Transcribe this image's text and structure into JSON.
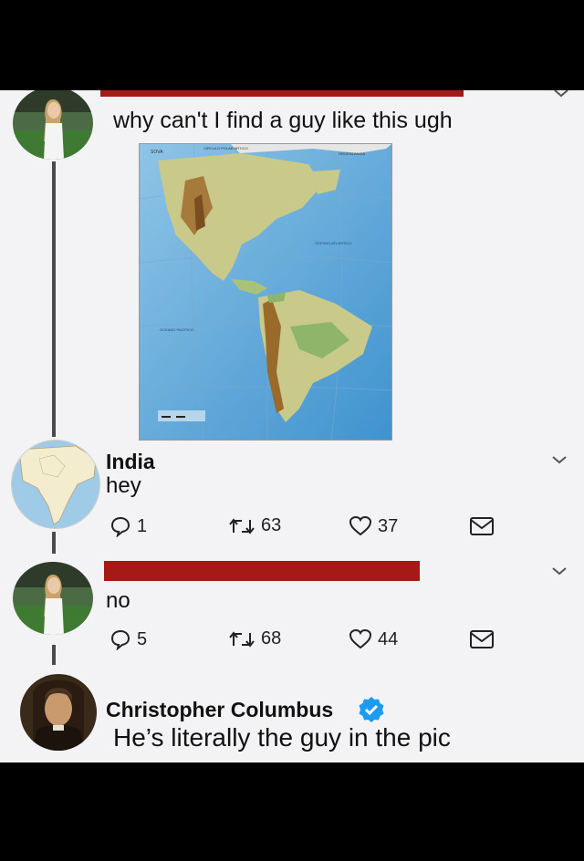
{
  "tweet1": {
    "text": "why can't I find a guy like this ugh"
  },
  "map": {
    "labels": {
      "top_left": "SOVA",
      "top": "CIRCULO POLAR ARTICO",
      "top_right": "GROENLANDIA",
      "ocean_right": "OCEANO ATLANTICO",
      "ocean_left": "OCEANO PACIFICO"
    }
  },
  "reply_india": {
    "name": "India",
    "text": "hey",
    "actions": {
      "replies": "1",
      "retweets": "63",
      "likes": "37"
    }
  },
  "reply2": {
    "text": "no",
    "actions": {
      "replies": "5",
      "retweets": "68",
      "likes": "44"
    }
  },
  "reply_columbus": {
    "name": "Christopher Columbus",
    "text": "He’s literally the guy in the pic",
    "verified": true
  },
  "colors": {
    "redaction": "#a51a14",
    "verified": "#1d9bf0",
    "panel": "#f3f3f5"
  }
}
